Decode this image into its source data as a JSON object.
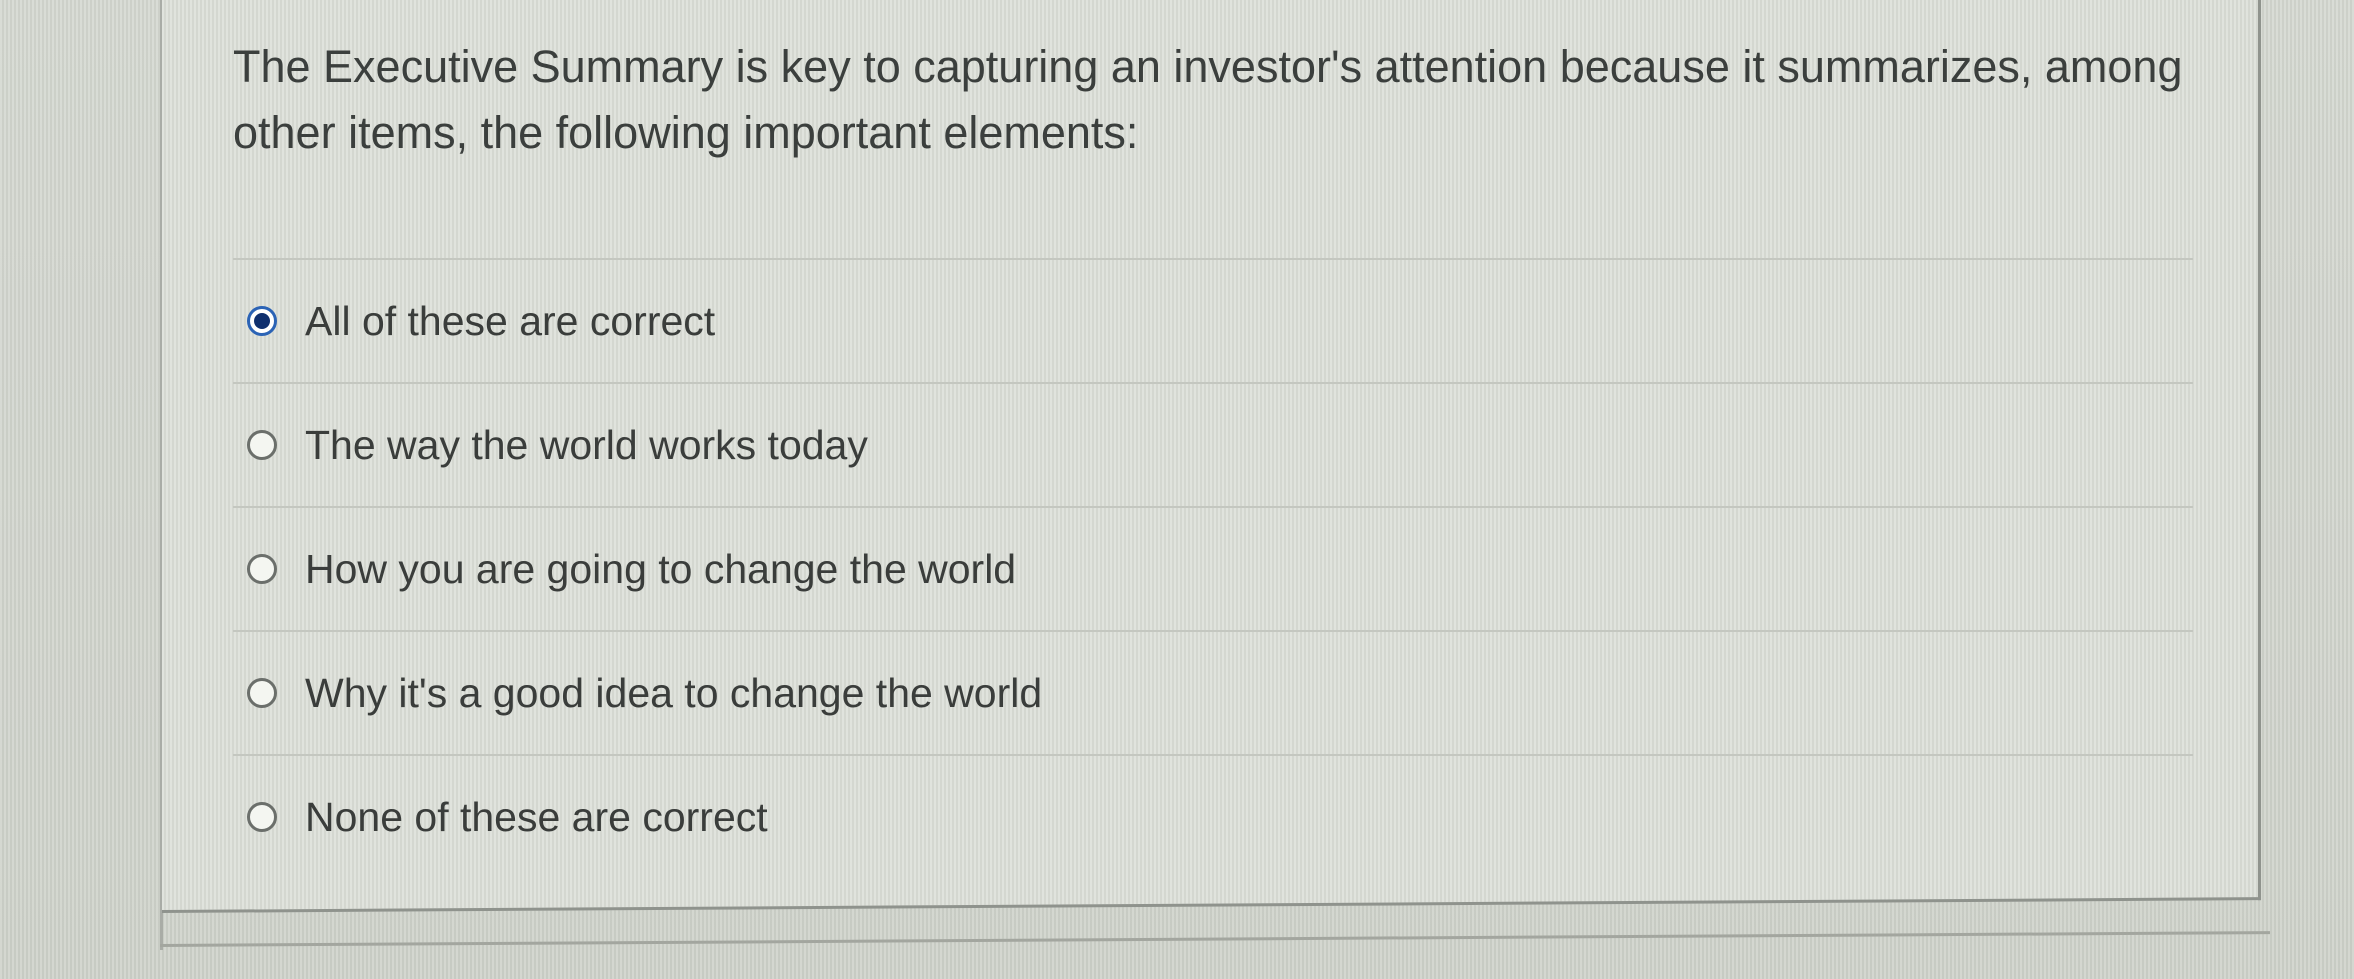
{
  "question": {
    "text": "The Executive Summary is key to capturing an investor's attention because it summarizes, among other items, the following important elements:"
  },
  "options": [
    {
      "label": "All of these are correct",
      "selected": true
    },
    {
      "label": "The way the world works today",
      "selected": false
    },
    {
      "label": "How you are going to change the world",
      "selected": false
    },
    {
      "label": "Why it's a good idea to change the world",
      "selected": false
    },
    {
      "label": "None of these are correct",
      "selected": false
    }
  ],
  "colors": {
    "background": "#d3d6cf",
    "selected_radio_border": "#2b63b5",
    "selected_radio_dot": "#0f2f6e",
    "text": "#3a3d3b"
  }
}
